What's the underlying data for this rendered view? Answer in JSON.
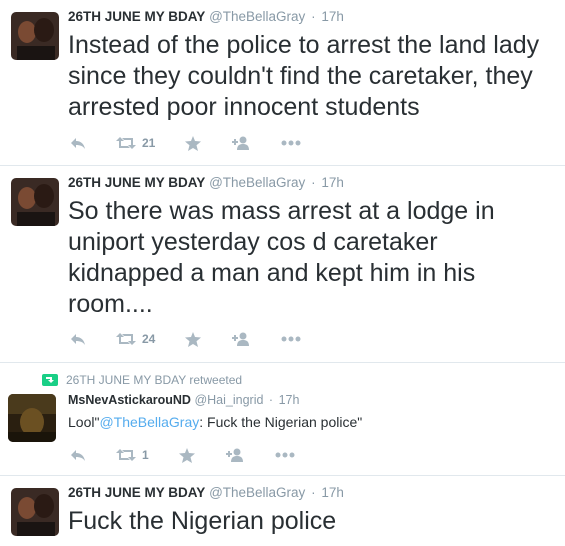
{
  "tweets": [
    {
      "name": "26TH JUNE MY BDAY",
      "handle": "@TheBellaGray",
      "time": "17h",
      "text": "Instead of the police to arrest the land lady since they couldn't find the caretaker, they arrested poor innocent students",
      "retweets": "21"
    },
    {
      "name": "26TH JUNE MY BDAY",
      "handle": "@TheBellaGray",
      "time": "17h",
      "text": "So there was mass arrest at a lodge in uniport yesterday cos d caretaker kidnapped a man and kept him in his room....",
      "retweets": "24"
    },
    {
      "retweeted_by": "26TH JUNE MY BDAY retweeted",
      "name": "MsNevAstickarouND",
      "handle": "@Hai_ingrid",
      "time": "17h",
      "text_prefix": "Lool\"",
      "text_link": "@TheBellaGray",
      "text_suffix": ": Fuck the Nigerian police\"",
      "retweets": "1"
    },
    {
      "name": "26TH JUNE MY BDAY",
      "handle": "@TheBellaGray",
      "time": "17h",
      "text": "Fuck the Nigerian police"
    }
  ],
  "separator": "·",
  "colors": {
    "text": "#292f33",
    "muted": "#8899a6",
    "icon": "#aab8c2",
    "link": "#55acee",
    "retweet_green": "#19cf86",
    "divider": "#e1e8ed"
  }
}
